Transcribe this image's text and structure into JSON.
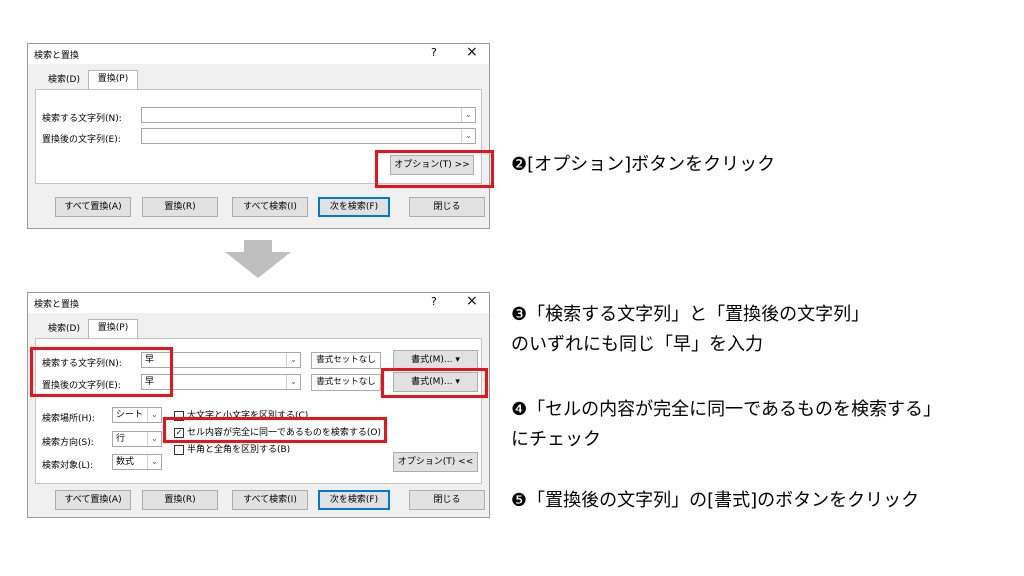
{
  "dialog_top": {
    "title": "検索と置換",
    "help": "?",
    "close": "×",
    "tabs": [
      "検索(D)",
      "置換(P)"
    ],
    "find_label": "検索する文字列(N):",
    "replace_label": "置換後の文字列(E):",
    "find_value": "",
    "replace_value": "",
    "options_button": "オプション(T) >>",
    "buttons": [
      "すべて置換(A)",
      "置換(R)",
      "すべて検索(I)",
      "次を検索(F)",
      "閉じる"
    ]
  },
  "dialog_bottom": {
    "title": "検索と置換",
    "help": "?",
    "close": "×",
    "tabs": [
      "検索(D)",
      "置換(P)"
    ],
    "find_label": "検索する文字列(N):",
    "replace_label": "置換後の文字列(E):",
    "find_value": "早",
    "replace_value": "早",
    "format_set_none_1": "書式セットなし",
    "format_set_none_2": "書式セットなし",
    "format_button_1": "書式(M)...",
    "format_button_2": "書式(M)...",
    "search_scope_label": "検索場所(H):",
    "search_scope_value": "シート",
    "search_direction_label": "検索方向(S):",
    "search_direction_value": "行",
    "search_target_label": "検索対象(L):",
    "search_target_value": "数式",
    "match_case": "大文字と小文字を区別する(C)",
    "match_entire": "セル内容が完全に同一であるものを検索する(O)",
    "match_width": "半角と全角を区別する(B)",
    "options_button": "オプション(T) <<",
    "buttons": [
      "すべて置換(A)",
      "置換(R)",
      "すべて検索(I)",
      "次を検索(F)",
      "閉じる"
    ]
  },
  "captions": {
    "step2": "❷[オプション]ボタンをクリック",
    "step3_line1": "❸「検索する文字列」と「置換後の文字列」",
    "step3_line2": "のいずれにも同じ「早」を入力",
    "step4_line1": "❹「セルの内容が完全に同一であるものを検索する」",
    "step4_line2": "にチェック",
    "step5": "❺「置換後の文字列」の[書式]のボタンをクリック"
  },
  "colors": {
    "highlight": "#e8141b",
    "arrow": "#bfbfbf",
    "default_button": "#0078d7"
  }
}
